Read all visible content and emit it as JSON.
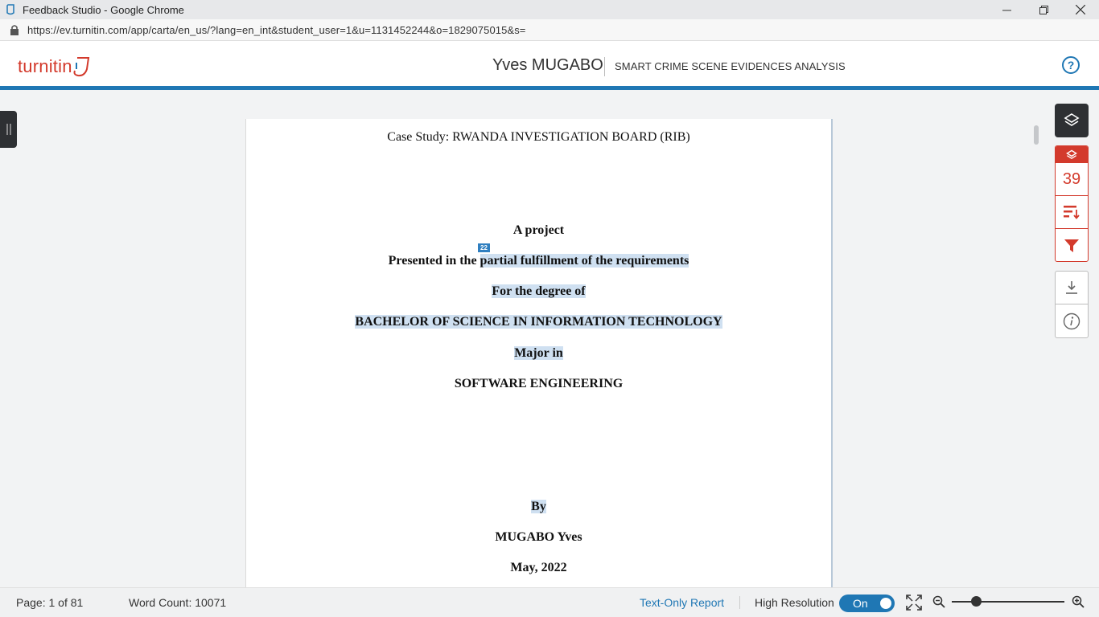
{
  "window": {
    "title": "Feedback Studio - Google Chrome",
    "url": "https://ev.turnitin.com/app/carta/en_us/?lang=en_int&student_user=1&u=1131452244&o=1829075015&s="
  },
  "header": {
    "logo": "turnitin",
    "author": "Yves MUGABO",
    "document_title": "SMART CRIME SCENE EVIDENCES ANALYSIS",
    "help": "?"
  },
  "document": {
    "lines": {
      "case_study": "Case Study: RWANDA INVESTIGATION BOARD (RIB)",
      "a_project": "A project",
      "presented_plain": "Presented in the ",
      "presented_hl": "partial fulfillment of the requirements",
      "degree": "For the degree of",
      "bachelor": "BACHELOR OF SCIENCE IN INFORMATION TECHNOLOGY",
      "major": "Major in",
      "software": "SOFTWARE ENGINEERING",
      "by": "By",
      "name": "MUGABO Yves",
      "date": "May, 2022"
    },
    "match_badge": "22"
  },
  "sidebar": {
    "similarity_score": "39"
  },
  "footer": {
    "page_info": "Page: 1 of 81",
    "word_count": "Word Count: 10071",
    "text_only_report": "Text-Only Report",
    "high_resolution_label": "High Resolution",
    "toggle_state": "On",
    "zoom_level": 0.22
  },
  "colors": {
    "brand_red": "#d33a2c",
    "brand_blue": "#1f77b4",
    "highlight": "#cfe0f1"
  }
}
